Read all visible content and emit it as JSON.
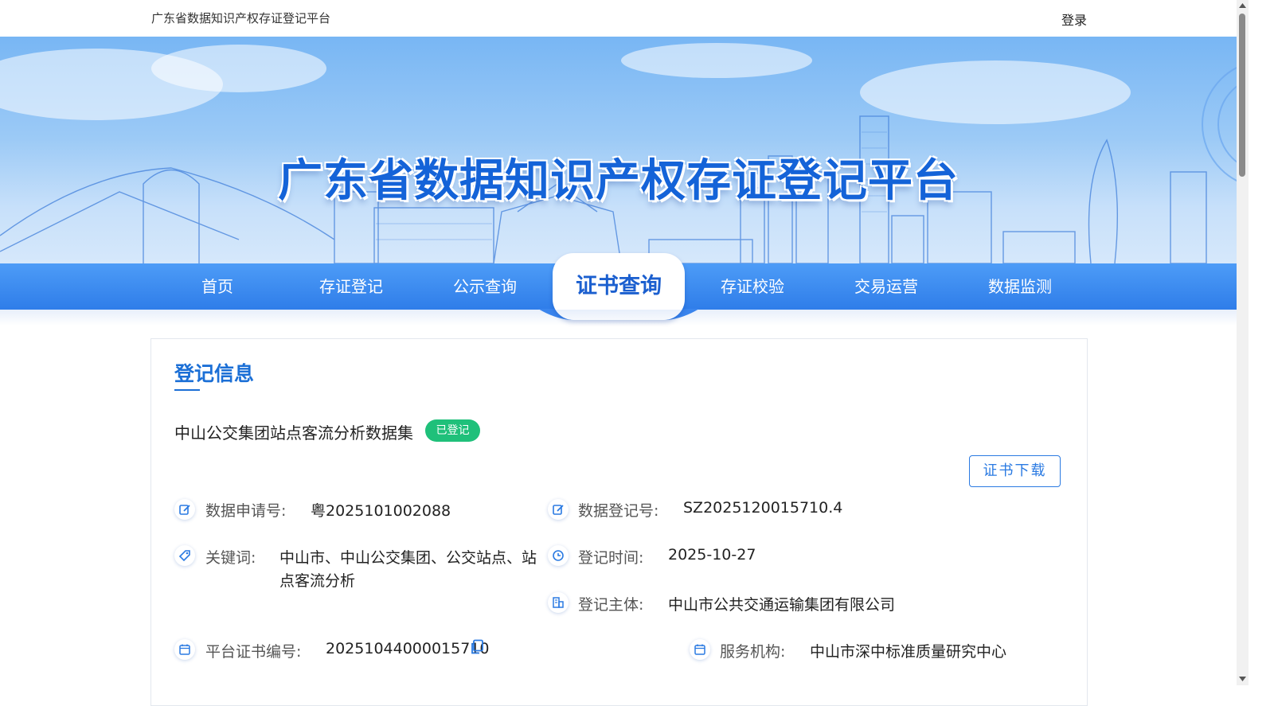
{
  "topbar": {
    "site_name": "广东省数据知识产权存证登记平台",
    "login": "登录"
  },
  "banner": {
    "title": "广东省数据知识产权存证登记平台"
  },
  "nav": {
    "items": [
      "首页",
      "存证登记",
      "公示查询",
      "证书查询",
      "存证校验",
      "交易运营",
      "数据监测"
    ],
    "active_index": 3
  },
  "section": {
    "title": "登记信息",
    "dataset_name": "中山公交集团站点客流分析数据集",
    "status": "已登记",
    "download": "证书下载"
  },
  "fields": {
    "application_no": {
      "label": "数据申请号:",
      "value": "粤2025101002088"
    },
    "registration_no": {
      "label": "数据登记号:",
      "value": "SZ2025120015710.4"
    },
    "keywords": {
      "label": "关键词:",
      "value_line1": "中山市、中山公交集团、公交站点、站",
      "value_line2": "点客流分析"
    },
    "registration_time": {
      "label": "登记时间:",
      "value": "2025-10-27"
    },
    "registrant": {
      "label": "登记主体:",
      "value": "中山市公共交通运输集团有限公司"
    },
    "certificate_no": {
      "label": "平台证书编号:",
      "value": "20251044000015710"
    },
    "service_org": {
      "label": "服务机构:",
      "value": "中山市深中标准质量研究中心"
    }
  },
  "colors": {
    "primary": "#2a7ae2",
    "nav": "#3a86ef",
    "badge": "#1fc07a",
    "title": "#1b6fd6"
  },
  "icons": [
    "edit-icon",
    "tag-icon",
    "clock-icon",
    "building-icon",
    "calendar-icon",
    "copy-icon"
  ]
}
